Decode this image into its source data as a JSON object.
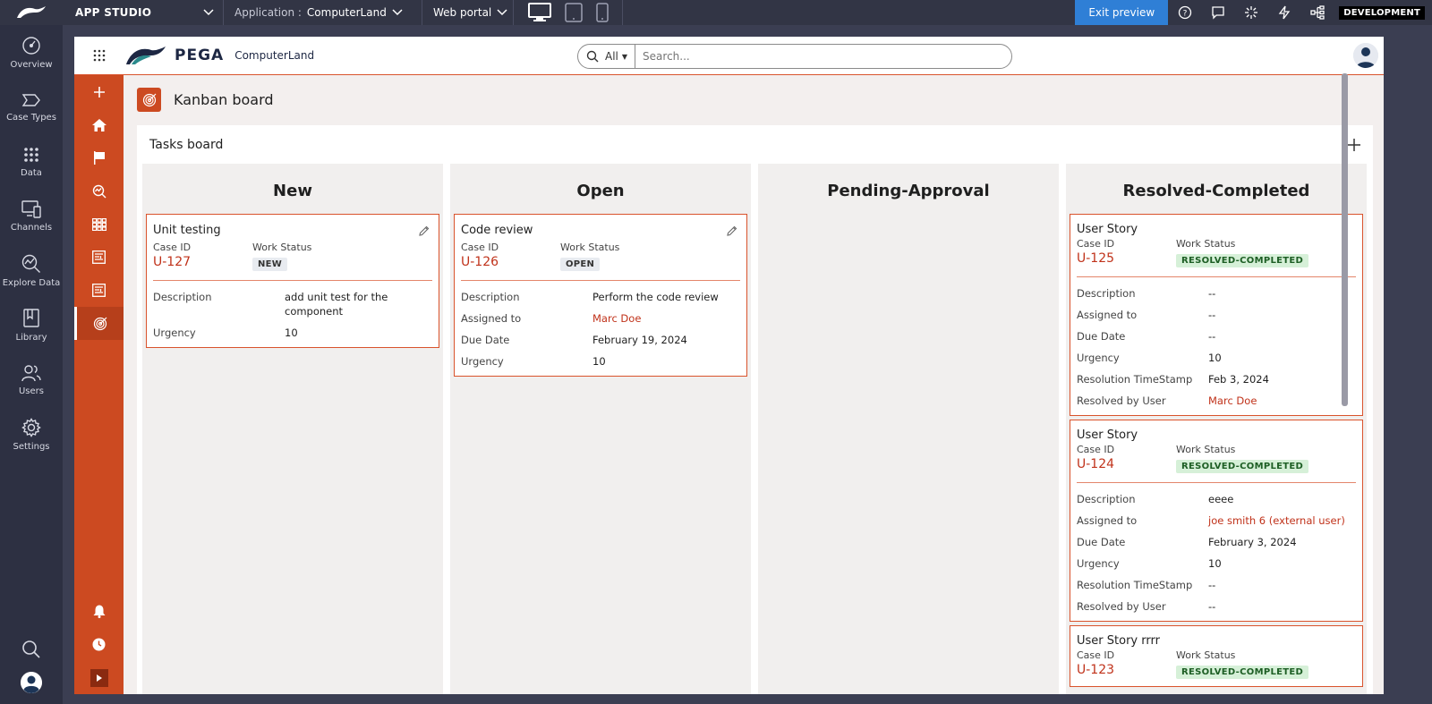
{
  "studio": {
    "title": "APP STUDIO",
    "application_label": "Application :",
    "application_name": "ComputerLand",
    "portal": "Web portal",
    "exit_preview": "Exit preview",
    "environment": "DEVELOPMENT"
  },
  "nav": {
    "items": [
      {
        "label": "Overview",
        "icon": "gauge-icon"
      },
      {
        "label": "Case Types",
        "icon": "case-type-icon"
      },
      {
        "label": "Data",
        "icon": "data-icon"
      },
      {
        "label": "Channels",
        "icon": "channels-icon"
      },
      {
        "label": "Explore Data",
        "icon": "explore-data-icon"
      },
      {
        "label": "Library",
        "icon": "library-icon"
      },
      {
        "label": "Users",
        "icon": "users-icon"
      },
      {
        "label": "Settings",
        "icon": "gear-icon"
      }
    ]
  },
  "header": {
    "brand": "PEGA",
    "app_name": "ComputerLand",
    "search_scope": "All",
    "search_placeholder": "Search..."
  },
  "page": {
    "title": "Kanban board"
  },
  "board": {
    "title": "Tasks board",
    "columns": [
      {
        "title": "New",
        "cards": [
          {
            "title": "Unit testing",
            "case_id_label": "Case ID",
            "case_id": "U-127",
            "status_label": "Work Status",
            "status": "NEW",
            "rows": [
              {
                "k": "Description",
                "v": "add unit test for the component"
              },
              {
                "k": "Urgency",
                "v": "10"
              }
            ]
          }
        ]
      },
      {
        "title": "Open",
        "cards": [
          {
            "title": "Code review",
            "case_id_label": "Case ID",
            "case_id": "U-126",
            "status_label": "Work Status",
            "status": "OPEN",
            "rows": [
              {
                "k": "Description",
                "v": "Perform the code review"
              },
              {
                "k": "Assigned to",
                "v": "Marc Doe"
              },
              {
                "k": "Due Date",
                "v": "February 19, 2024"
              },
              {
                "k": "Urgency",
                "v": "10"
              }
            ]
          }
        ]
      },
      {
        "title": "Pending-Approval",
        "cards": []
      },
      {
        "title": "Resolved-Completed",
        "cards": [
          {
            "title": "User Story",
            "case_id_label": "Case ID",
            "case_id": "U-125",
            "status_label": "Work Status",
            "status": "RESOLVED-COMPLETED",
            "rows": [
              {
                "k": "Description",
                "v": "--"
              },
              {
                "k": "Assigned to",
                "v": "--"
              },
              {
                "k": "Due Date",
                "v": "--"
              },
              {
                "k": "Urgency",
                "v": "10"
              },
              {
                "k": "Resolution TimeStamp",
                "v": "Feb 3, 2024"
              },
              {
                "k": "Resolved by User",
                "v": "Marc Doe"
              }
            ]
          },
          {
            "title": "User Story",
            "case_id_label": "Case ID",
            "case_id": "U-124",
            "status_label": "Work Status",
            "status": "RESOLVED-COMPLETED",
            "rows": [
              {
                "k": "Description",
                "v": "eeee"
              },
              {
                "k": "Assigned to",
                "v": "joe smith 6 (external user)"
              },
              {
                "k": "Due Date",
                "v": "February 3, 2024"
              },
              {
                "k": "Urgency",
                "v": "10"
              },
              {
                "k": "Resolution TimeStamp",
                "v": "--"
              },
              {
                "k": "Resolved by User",
                "v": "--"
              }
            ]
          },
          {
            "title": "User Story rrrr",
            "case_id_label": "Case ID",
            "case_id": "U-123",
            "status_label": "Work Status",
            "status": "RESOLVED-COMPLETED",
            "rows": []
          }
        ]
      }
    ]
  },
  "colors": {
    "accent": "#cc4a21",
    "link": "#c0321a",
    "studio_bar": "#323545",
    "exit_button": "#2f7fd6"
  }
}
